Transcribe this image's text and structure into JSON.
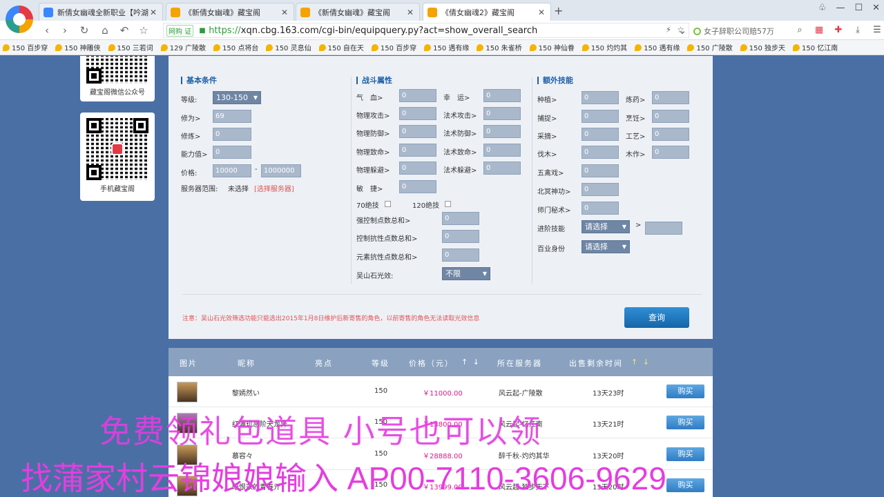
{
  "browser": {
    "tabs": [
      {
        "label": "新倩女幽魂全新职业【吟湖】上",
        "favicon_color": "#3a86ff",
        "active": false
      },
      {
        "label": "《新倩女幽魂》藏宝阁",
        "favicon_color": "#f4a300",
        "active": false
      },
      {
        "label": "《新倩女幽魂》藏宝阁",
        "favicon_color": "#f4a300",
        "active": false
      },
      {
        "label": "《倩女幽魂2》藏宝阁",
        "favicon_color": "#f4a300",
        "active": true
      }
    ],
    "new_tab": "+",
    "url_badge": "网购 证",
    "url_scheme": "https://",
    "url_rest": "xqn.cbg.163.com/cgi-bin/equipquery.py?act=show_overall_search",
    "search_suggest": "女子辞职公司赔57万",
    "bookmarks": [
      "150 百步穿",
      "150 神雕侠",
      "150 三若词",
      "129 广陵散",
      "150 点将台",
      "150 灵息仙",
      "150 自在天",
      "150 百步穿",
      "150 遇有缘",
      "150 朱雀桥",
      "150 神仙眷",
      "150 灼灼其",
      "150 遇有缘",
      "150 广陵散",
      "150 独步天",
      "150 忆江南"
    ]
  },
  "sidebar": {
    "wechat_caption": "藏宝阁微信公众号",
    "mobile_caption": "手机藏宝阁"
  },
  "search": {
    "basic": {
      "title": "基本条件",
      "level_label": "等级:",
      "level_value": "130-150",
      "xiuwei_label": "修为>",
      "xiuwei_value": "69",
      "xiulian_label": "修炼>",
      "xiulian_value": "0",
      "ability_label": "能力值>",
      "ability_value": "0",
      "price_label": "价格:",
      "price_min": "10000",
      "price_sep": "-",
      "price_max": "1000000",
      "server_label": "服务器范围:",
      "server_value": "未选择",
      "server_link": "[选择服务器]"
    },
    "battle": {
      "title": "战斗属性",
      "rows": [
        {
          "l1": "气　血>",
          "v1": "0",
          "l2": "幸　运>",
          "v2": "0"
        },
        {
          "l1": "物理攻击>",
          "v1": "0",
          "l2": "法术攻击>",
          "v2": "0"
        },
        {
          "l1": "物理防御>",
          "v1": "0",
          "l2": "法术防御>",
          "v2": "0"
        },
        {
          "l1": "物理致命>",
          "v1": "0",
          "l2": "法术致命>",
          "v2": "0"
        },
        {
          "l1": "物理躲避>",
          "v1": "0",
          "l2": "法术躲避>",
          "v2": "0"
        }
      ],
      "jiezhi_label": "敏　捷>",
      "jiezhi_value": "0",
      "skill70_label": "70绝技",
      "skill120_label": "120绝技",
      "control_label": "强控制点数总和>",
      "control_value": "0",
      "resist_label": "控制抗性点数总和>",
      "resist_value": "0",
      "element_label": "元素抗性点数总和>",
      "element_value": "0",
      "wushan_label": "吴山石光效:",
      "wushan_value": "不限"
    },
    "extra": {
      "title": "额外技能",
      "rows": [
        {
          "l1": "种植>",
          "v1": "0",
          "l2": "炼药>",
          "v2": "0"
        },
        {
          "l1": "捕捉>",
          "v1": "0",
          "l2": "烹饪>",
          "v2": "0"
        },
        {
          "l1": "采摘>",
          "v1": "0",
          "l2": "工艺>",
          "v2": "0"
        },
        {
          "l1": "伐木>",
          "v1": "0",
          "l2": "木作>",
          "v2": "0"
        }
      ],
      "wuqin_label": "五禽戏>",
      "wuqin_value": "0",
      "beiming_label": "北冥神功>",
      "beiming_value": "0",
      "shimen_label": "师门秘术>",
      "shimen_value": "0",
      "advance_label": "进阶技能",
      "advance_value": "请选择",
      "advance_gt": ">",
      "baiye_label": "百业身份",
      "baiye_value": "请选择"
    },
    "notice": "注意：吴山石光效筛选功能只能选出2015年1月8日维护后新寄售的角色，以前寄售的角色无法读取光效信息",
    "query_button": "查询"
  },
  "results": {
    "headers": {
      "image": "图片",
      "name": "昵称",
      "highlight": "亮点",
      "level": "等级",
      "price": "价格（元）",
      "price_sort": "↑ ↓",
      "server": "所在服务器",
      "time": "出售剩余时间",
      "time_sort": "↑ ↓"
    },
    "rows": [
      {
        "name": "黎嫣然い",
        "level": "150",
        "price": "￥11000.00",
        "server": "风云起-广陵散",
        "time": "13天23时",
        "buy": "购买"
      },
      {
        "name": "红满玑恶阶天龙异",
        "level": "150",
        "price": "￥13800.00",
        "server": "风云起-忆江南",
        "time": "13天21时",
        "buy": "购买"
      },
      {
        "name": "慕容々",
        "level": "150",
        "price": "￥28888.00",
        "server": "醉千秋-灼灼其华",
        "time": "13天20时",
        "buy": "购买"
      },
      {
        "name": "暗恨苡的青春亓",
        "level": "150",
        "price": "￥13999.00",
        "server": "风云起-独步天下",
        "time": "13天20时",
        "buy": "购买"
      }
    ]
  },
  "overlay": {
    "line1": "免费领礼包道具 小号也可以领",
    "line2": "找蒲家村云锦娘娘输入 AP00-7110-3606-9629"
  }
}
